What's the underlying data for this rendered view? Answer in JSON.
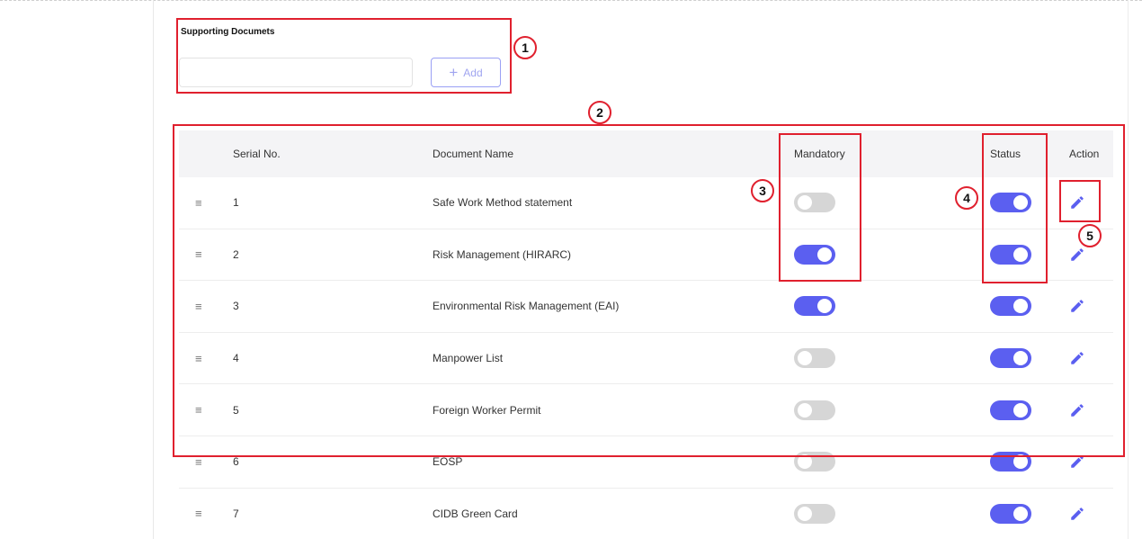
{
  "section": {
    "title": "Supporting Documets",
    "input_value": "",
    "add_label": "Add"
  },
  "table": {
    "headers": {
      "serial": "Serial No.",
      "name": "Document Name",
      "mandatory": "Mandatory",
      "status": "Status",
      "action": "Action"
    },
    "rows": [
      {
        "serial": "1",
        "name": "Safe Work Method statement",
        "mandatory": false,
        "status": true
      },
      {
        "serial": "2",
        "name": "Risk Management (HIRARC)",
        "mandatory": true,
        "status": true
      },
      {
        "serial": "3",
        "name": "Environmental Risk Management (EAI)",
        "mandatory": true,
        "status": true
      },
      {
        "serial": "4",
        "name": "Manpower List",
        "mandatory": false,
        "status": true
      },
      {
        "serial": "5",
        "name": "Foreign Worker Permit",
        "mandatory": false,
        "status": true
      },
      {
        "serial": "6",
        "name": "EOSP",
        "mandatory": false,
        "status": true
      },
      {
        "serial": "7",
        "name": "CIDB Green Card",
        "mandatory": false,
        "status": true
      }
    ]
  },
  "annotations": [
    "1",
    "2",
    "3",
    "4",
    "5"
  ],
  "icons": {
    "drag": "drag-handle-icon",
    "edit": "pencil-icon",
    "add": "plus-icon"
  },
  "colors": {
    "accent": "#5b5ff0",
    "toggle_off": "#d6d6d6",
    "annotation": "#e0202e"
  }
}
